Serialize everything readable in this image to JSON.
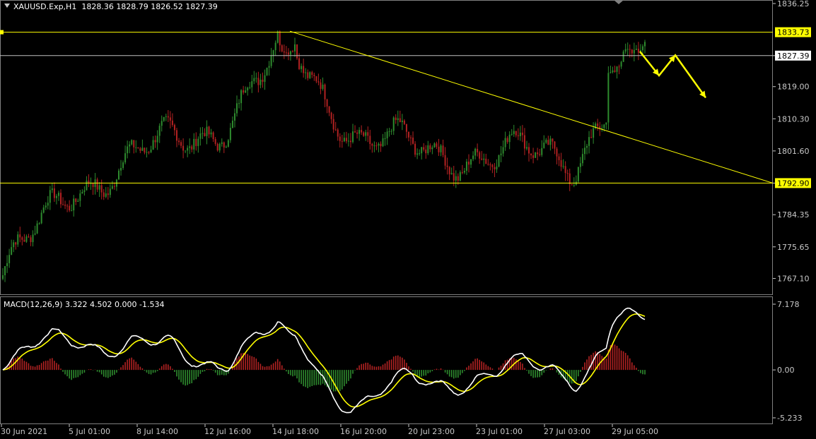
{
  "header": {
    "symbol": "XAUUSD.Exp,H1",
    "ohlc": "1828.36 1828.79 1826.52 1827.39"
  },
  "macd_header": "MACD(12,26,9) 3.322 4.502 0.000 -1.534",
  "price_axis": {
    "ticks": [
      "1836.25",
      "1827.39",
      "1819.00",
      "1810.30",
      "1801.60",
      "1792.90",
      "1784.35",
      "1775.65",
      "1767.10"
    ],
    "highlight_labels": [
      "1833.73",
      "1792.90"
    ],
    "current_price_label": "1827.39"
  },
  "macd_axis": {
    "ticks": [
      "7.178",
      "0.00",
      "-5.233"
    ]
  },
  "time_axis": {
    "labels": [
      "30 Jun 2021",
      "5 Jul 01:00",
      "8 Jul 14:00",
      "12 Jul 16:00",
      "14 Jul 18:00",
      "16 Jul 20:00",
      "20 Jul 23:00",
      "23 Jul 01:00",
      "27 Jul 03:00",
      "29 Jul 05:00"
    ]
  },
  "colors": {
    "background": "#000000",
    "bull": "#2e8b2e",
    "bear": "#b22222",
    "annotation": "#ffff00",
    "axis_text": "#c8c8c8",
    "grid": "#c0c0c0",
    "macd_line": "#ffffff",
    "signal_line": "#ffff00"
  },
  "chart_data": [
    {
      "type": "candlestick",
      "title": "XAUUSD.Exp,H1",
      "ylim": [
        1763.0,
        1839.0
      ],
      "horizontal_levels": [
        1833.73,
        1792.9,
        1827.39
      ],
      "trendline": {
        "from": [
          "14 Jul 18:00",
          1834.0
        ],
        "to": [
          "end",
          1792.9
        ]
      },
      "projected_path": [
        1828.5,
        1822.0,
        1827.5,
        1816.0
      ],
      "approx_price_path": {
        "x": [
          "30 Jun 2021",
          "5 Jul 01:00",
          "8 Jul 14:00",
          "12 Jul 16:00",
          "14 Jul 18:00",
          "16 Jul 20:00",
          "20 Jul 23:00",
          "23 Jul 01:00",
          "27 Jul 03:00",
          "29 Jul 05:00"
        ],
        "y": [
          1768.0,
          1792.0,
          1801.0,
          1808.0,
          1830.0,
          1805.0,
          1801.0,
          1801.0,
          1799.0,
          1831.0
        ]
      }
    },
    {
      "type": "line",
      "title": "MACD(12,26,9) 3.322 4.502 0.000 -1.534",
      "ylim": [
        -5.233,
        7.178
      ],
      "series_values_at_end": {
        "macd": 3.322,
        "signal": 4.502,
        "histogram": -1.534
      }
    }
  ]
}
